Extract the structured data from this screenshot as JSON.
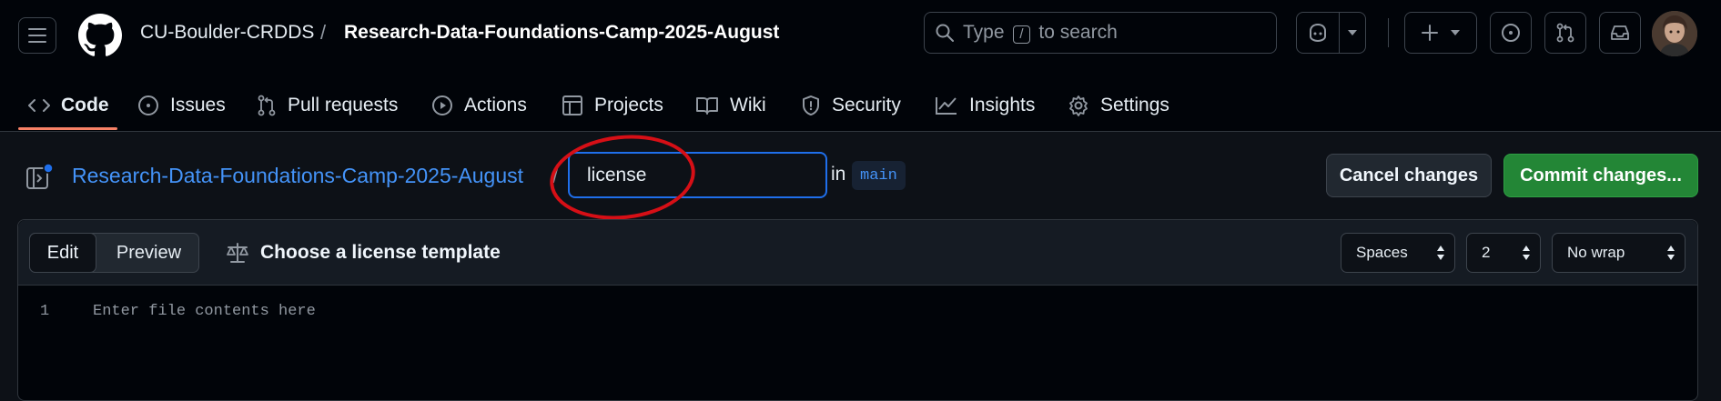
{
  "header": {
    "owner": "CU-Boulder-CRDDS",
    "separator": "/",
    "repo": "Research-Data-Foundations-Camp-2025-August",
    "search": {
      "prefix": "Type",
      "key": "/",
      "suffix": "to search"
    }
  },
  "tabs": [
    {
      "label": "Code",
      "icon": "code-icon",
      "active": true
    },
    {
      "label": "Issues",
      "icon": "issue-icon"
    },
    {
      "label": "Pull requests",
      "icon": "pull-request-icon"
    },
    {
      "label": "Actions",
      "icon": "play-icon"
    },
    {
      "label": "Projects",
      "icon": "table-icon"
    },
    {
      "label": "Wiki",
      "icon": "book-icon"
    },
    {
      "label": "Security",
      "icon": "shield-icon"
    },
    {
      "label": "Insights",
      "icon": "graph-icon"
    },
    {
      "label": "Settings",
      "icon": "gear-icon"
    }
  ],
  "editor": {
    "repo_link": "Research-Data-Foundations-Camp-2025-August",
    "path_sep": "/",
    "filename_value": "license",
    "in_label": "in",
    "branch": "main",
    "cancel_label": "Cancel changes",
    "commit_label": "Commit changes...",
    "mode_edit": "Edit",
    "mode_preview": "Preview",
    "license_template_label": "Choose a license template",
    "indent_mode": "Spaces",
    "indent_size": "2",
    "wrap_mode": "No wrap",
    "line_number": "1",
    "placeholder": "Enter file contents here"
  },
  "colors": {
    "accent_link": "#4493f8",
    "commit_green": "#238636",
    "annotation_red": "#d60f16",
    "active_tab_underline": "#f78166"
  }
}
